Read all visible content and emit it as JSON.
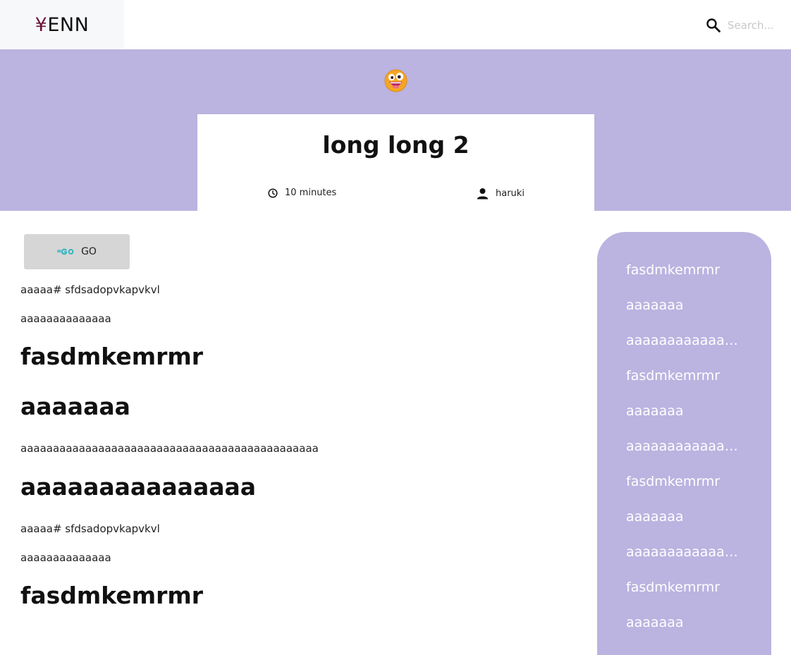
{
  "header": {
    "logo_symbol": "¥",
    "logo_text": "ENN",
    "search_placeholder": "Search..."
  },
  "post": {
    "emoji": "zany-face-emoji",
    "title": "long long 2",
    "read_time": "10 minutes",
    "author": "haruki",
    "tag": {
      "label": "GO",
      "icon": "go-logo-icon"
    },
    "body": [
      {
        "type": "p",
        "text": "aaaaa# sfdsadopvkapvkvl"
      },
      {
        "type": "p",
        "text": "aaaaaaaaaaaaaa"
      },
      {
        "type": "h",
        "text": "fasdmkemrmr"
      },
      {
        "type": "h",
        "text": "aaaaaaa"
      },
      {
        "type": "p",
        "text": "aaaaaaaaaaaaaaaaaaaaaaaaaaaaaaaaaaaaaaaaaaaaaa"
      },
      {
        "type": "h",
        "text": "aaaaaaaaaaaaaaa"
      },
      {
        "type": "p",
        "text": "aaaaa# sfdsadopvkapvkvl"
      },
      {
        "type": "p",
        "text": "aaaaaaaaaaaaaa"
      },
      {
        "type": "h",
        "text": "fasdmkemrmr"
      }
    ]
  },
  "toc": {
    "items": [
      "fasdmkemrmr",
      "aaaaaaa",
      "aaaaaaaaaaaaaaa",
      "fasdmkemrmr",
      "aaaaaaa",
      "aaaaaaaaaaaaaaa",
      "fasdmkemrmr",
      "aaaaaaa",
      "aaaaaaaaaaaaaaa",
      "fasdmkemrmr",
      "aaaaaaa"
    ]
  },
  "colors": {
    "accent": "#bbb3e0",
    "logo_bg": "#f6f8fa",
    "tag_bg": "#d6d6d6",
    "go_icon": "#2fb2bd",
    "logo_yen": "#6b1438"
  }
}
